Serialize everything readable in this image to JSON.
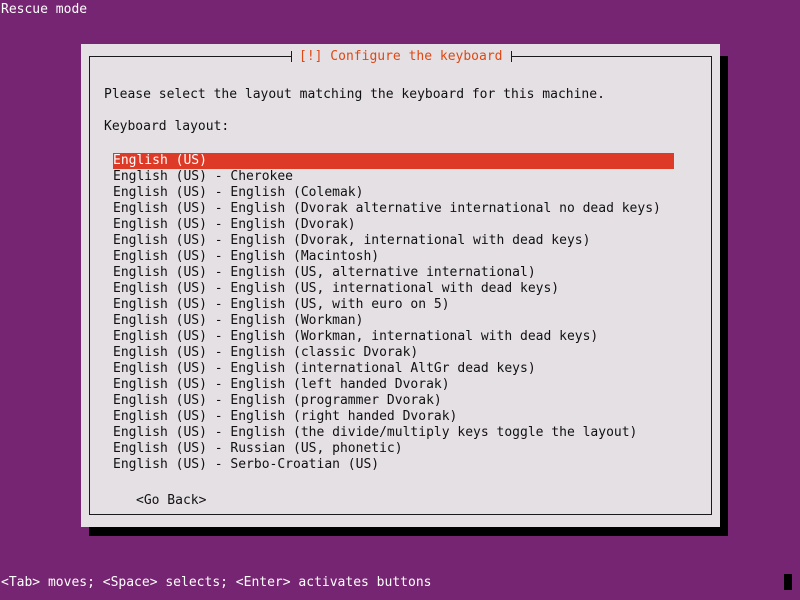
{
  "colors": {
    "desktop_background": "#762572",
    "dialog_background": "#e4e0e4",
    "dialog_border": "#1a1a1a",
    "title_accent": "#dd4814",
    "selection_background": "#dd3b27",
    "selection_text": "#ffffff",
    "shadow": "#000000",
    "status_text": "#ffffff"
  },
  "screen": {
    "mode_label": "Rescue mode",
    "help_line": "<Tab> moves; <Space> selects; <Enter> activates buttons"
  },
  "dialog": {
    "title": "[!] Configure the keyboard",
    "intro_text": "Please select the layout matching the keyboard for this machine.",
    "field_label": "Keyboard layout:",
    "go_back_label": "<Go Back>",
    "selected_index": 0,
    "options": [
      "English (US)",
      "English (US) - Cherokee",
      "English (US) - English (Colemak)",
      "English (US) - English (Dvorak alternative international no dead keys)",
      "English (US) - English (Dvorak)",
      "English (US) - English (Dvorak, international with dead keys)",
      "English (US) - English (Macintosh)",
      "English (US) - English (US, alternative international)",
      "English (US) - English (US, international with dead keys)",
      "English (US) - English (US, with euro on 5)",
      "English (US) - English (Workman)",
      "English (US) - English (Workman, international with dead keys)",
      "English (US) - English (classic Dvorak)",
      "English (US) - English (international AltGr dead keys)",
      "English (US) - English (left handed Dvorak)",
      "English (US) - English (programmer Dvorak)",
      "English (US) - English (right handed Dvorak)",
      "English (US) - English (the divide/multiply keys toggle the layout)",
      "English (US) - Russian (US, phonetic)",
      "English (US) - Serbo-Croatian (US)"
    ]
  }
}
